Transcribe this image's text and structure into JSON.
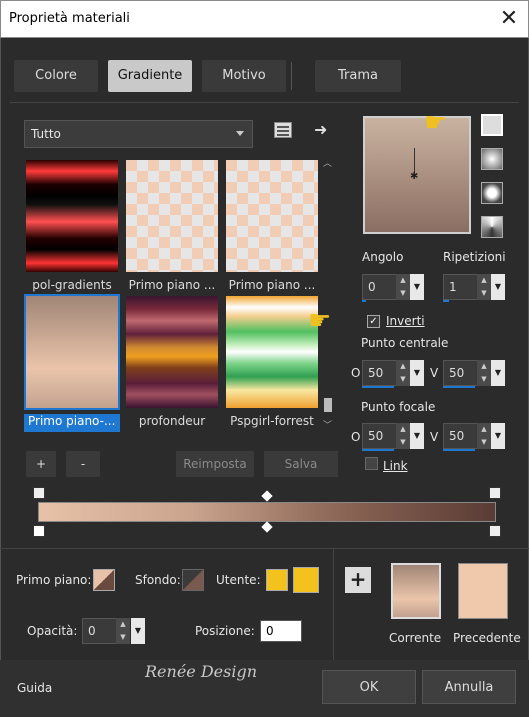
{
  "window": {
    "title": "Proprietà materiali",
    "close": "✕"
  },
  "tabs": [
    "Colore",
    "Gradiente",
    "Motivo",
    "Trama"
  ],
  "category": {
    "value": "Tutto"
  },
  "swatches": [
    {
      "label": "pol-gradients"
    },
    {
      "label": "Primo piano ..."
    },
    {
      "label": "Primo piano ..."
    },
    {
      "label": "Primo piano-..."
    },
    {
      "label": "profondeur"
    },
    {
      "label": "Pspgirl-forrest"
    }
  ],
  "buttons": {
    "add": "+",
    "remove": "-",
    "reset": "Reimposta",
    "save": "Salva",
    "ok": "OK",
    "cancel": "Annulla",
    "help": "Guida"
  },
  "angle": {
    "label": "Angolo",
    "value": "0"
  },
  "repeats": {
    "label": "Ripetizioni",
    "value": "1"
  },
  "invert": {
    "label": "Inverti",
    "checked": true
  },
  "center": {
    "label": "Punto centrale",
    "h_prefix": "O",
    "v_prefix": "V",
    "h": "50",
    "v": "50"
  },
  "focal": {
    "label": "Punto focale",
    "h_prefix": "O",
    "v_prefix": "V",
    "h": "50",
    "v": "50"
  },
  "link": {
    "label": "Link"
  },
  "foreground": {
    "label": "Primo piano:"
  },
  "background": {
    "label": "Sfondo:"
  },
  "user": {
    "label": "Utente:",
    "color": "#f3c21d"
  },
  "opacity": {
    "label": "Opacità:",
    "value": "0"
  },
  "position": {
    "label": "Posizione:",
    "value": "0"
  },
  "current": {
    "label": "Corrente"
  },
  "previous": {
    "label": "Precedente",
    "color": "#f0c9ac"
  },
  "watermark": "Renée Design",
  "colors": {
    "accent": "#1e78d2",
    "gradient_start": "#e8c1a9",
    "gradient_end": "#5a3c35"
  }
}
